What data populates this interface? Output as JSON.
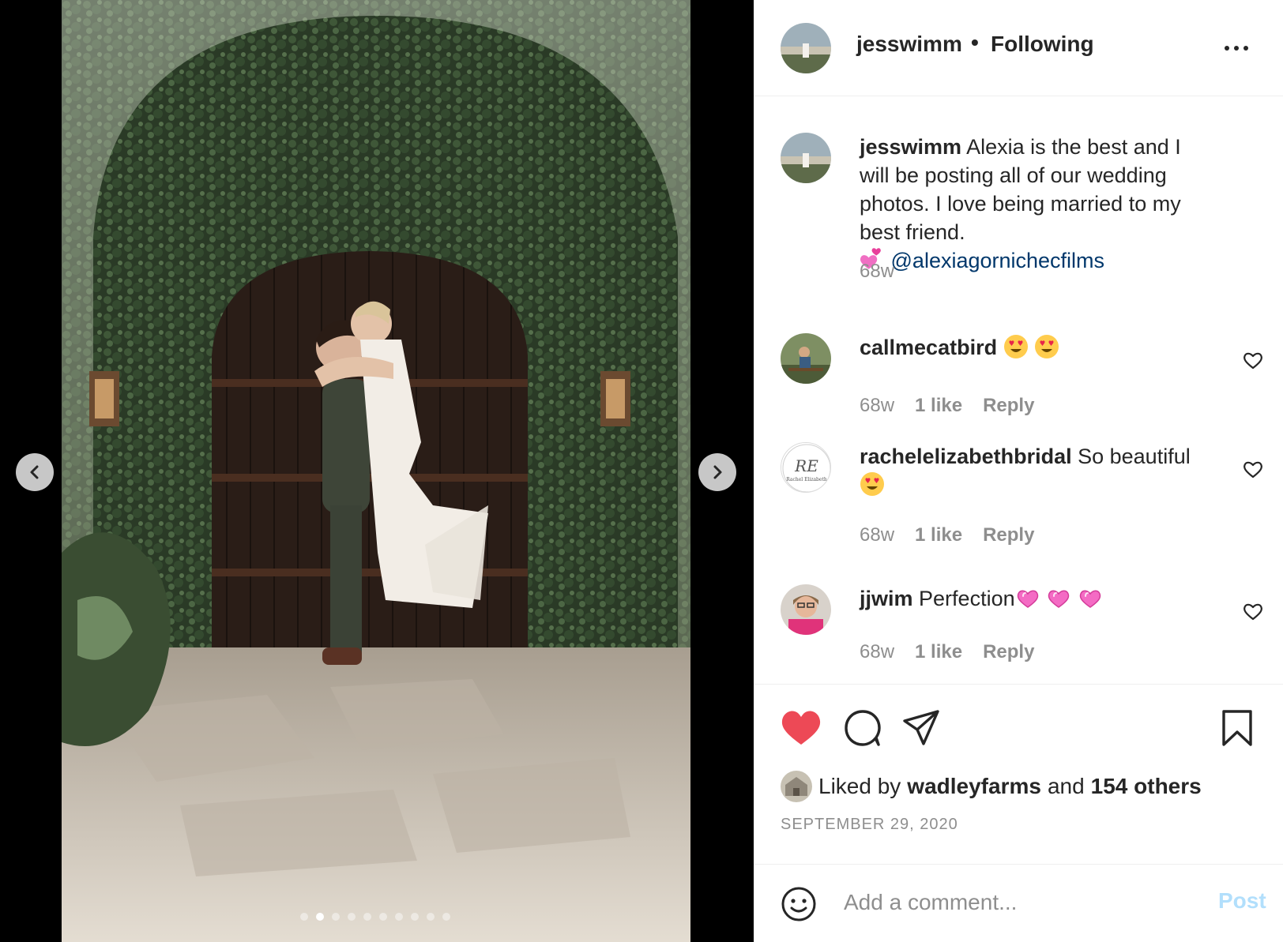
{
  "post": {
    "username": "jesswimm",
    "separator": "•",
    "follow_status": "Following",
    "caption_username": "jesswimm",
    "caption_text": "Alexia is the best and I will be posting all of our wedding photos. I love being married to my best friend.",
    "caption_emoji": "two-hearts",
    "caption_mention": "@alexiagornichecfilms",
    "caption_time": "68w"
  },
  "comments": [
    {
      "username": "callmecatbird",
      "text": "",
      "emoji": [
        "heart-eyes",
        "heart-eyes"
      ],
      "time": "68w",
      "likes": "1 like",
      "reply": "Reply"
    },
    {
      "username": "rachelelizabethbridal",
      "text": "So beautiful",
      "emoji": [
        "heart-eyes"
      ],
      "time": "68w",
      "likes": "1 like",
      "reply": "Reply",
      "avatar_logo_text": "RE",
      "avatar_logo_sub": "Rachel Elizabeth"
    },
    {
      "username": "jjwim",
      "text": "Perfection",
      "emoji": [
        "pink-heart",
        "pink-heart",
        "pink-heart"
      ],
      "time": "68w",
      "likes": "1 like",
      "reply": "Reply"
    }
  ],
  "likes": {
    "prefix": "Liked by",
    "user": "wadleyfarms",
    "middle": "and",
    "others": "154 others"
  },
  "date": "SEPTEMBER 29, 2020",
  "add_comment": {
    "placeholder": "Add a comment...",
    "post_label": "Post"
  },
  "carousel": {
    "count": 10,
    "active_index": 1
  },
  "colors": {
    "liked_heart": "#ed4956",
    "mention": "#00376b",
    "post_disabled": "#b2dffc",
    "meta": "#8e8e8e"
  },
  "icons": [
    "chevron-left-icon",
    "chevron-right-icon",
    "more-icon",
    "heart-icon",
    "comment-icon",
    "share-icon",
    "bookmark-icon",
    "smile-icon"
  ]
}
